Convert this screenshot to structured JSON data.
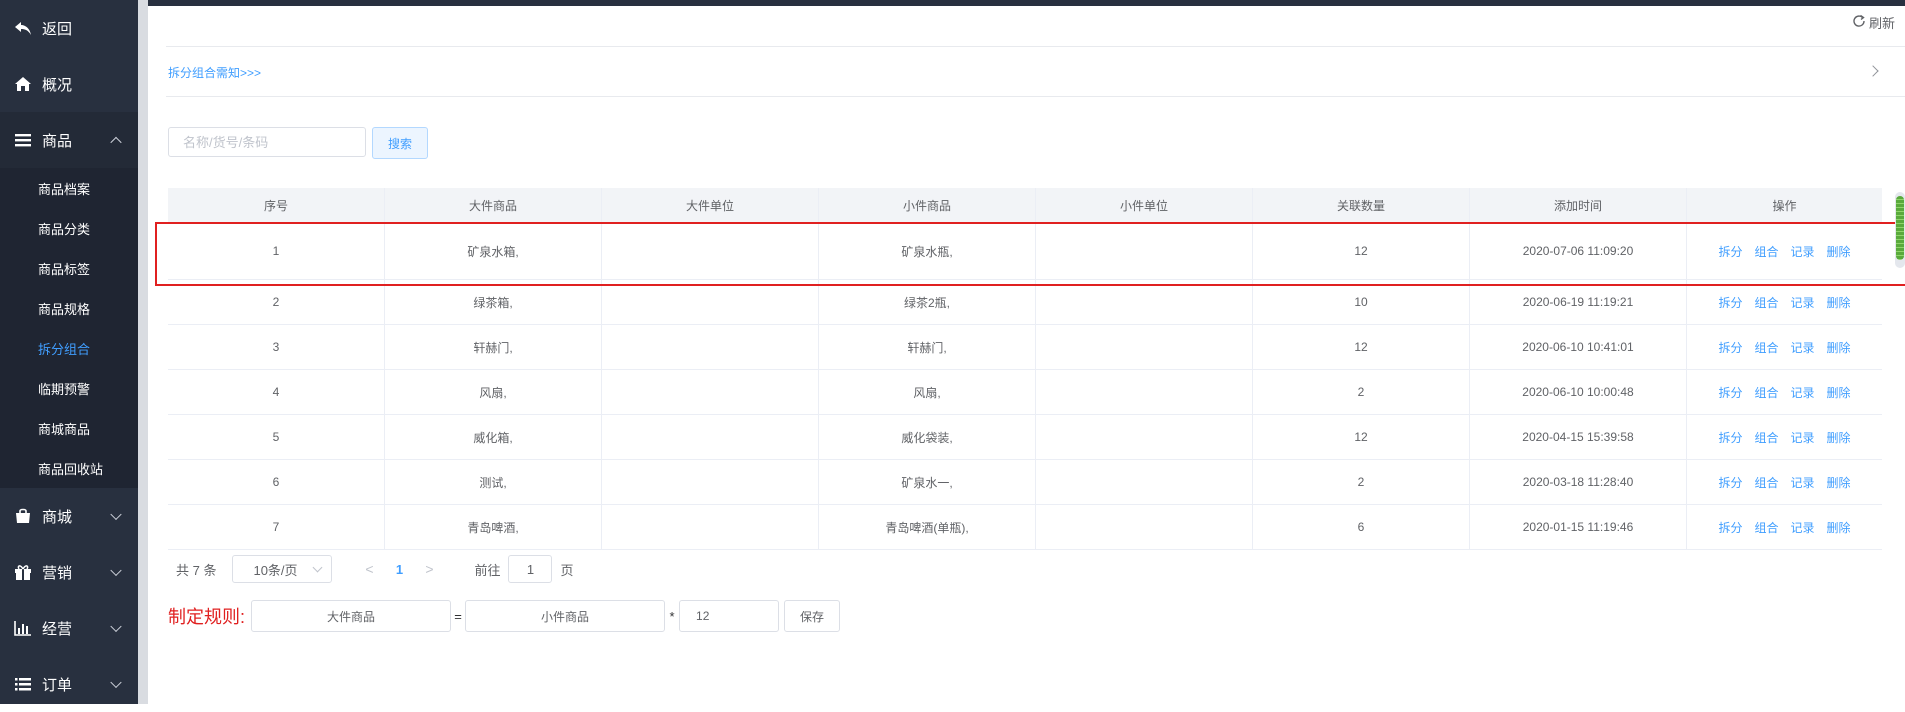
{
  "sidebar": {
    "back": {
      "label": "返回",
      "icon": "back-arrow-icon"
    },
    "overview": {
      "label": "概况",
      "icon": "home-icon"
    },
    "goods": {
      "label": "商品",
      "icon": "menu-icon"
    },
    "goods_sub": [
      "商品档案",
      "商品分类",
      "商品标签",
      "商品规格",
      "拆分组合",
      "临期预警",
      "商城商品",
      "商品回收站"
    ],
    "active_sub": "拆分组合",
    "mall": {
      "label": "商城",
      "icon": "shopping-bag-icon"
    },
    "marketing": {
      "label": "营销",
      "icon": "gift-icon"
    },
    "operation": {
      "label": "经营",
      "icon": "bar-chart-icon"
    },
    "orders": {
      "label": "订单",
      "icon": "list-icon"
    }
  },
  "header": {
    "refresh_label": "刷新",
    "refresh_icon": "refresh-icon"
  },
  "notice": {
    "label": "拆分组合需知>>>"
  },
  "search": {
    "placeholder": "名称/货号/条码",
    "button_label": "搜索"
  },
  "table": {
    "columns": [
      "序号",
      "大件商品",
      "大件单位",
      "小件商品",
      "小件单位",
      "关联数量",
      "添加时间",
      "操作"
    ],
    "actions": [
      "拆分",
      "组合",
      "记录",
      "删除"
    ],
    "rows": [
      {
        "index": "1",
        "big": "矿泉水箱,",
        "big_unit": "",
        "small": "矿泉水瓶,",
        "small_unit": "",
        "qty": "12",
        "time": "2020-07-06 11:09:20"
      },
      {
        "index": "2",
        "big": "绿茶箱,",
        "big_unit": "",
        "small": "绿茶2瓶,",
        "small_unit": "",
        "qty": "10",
        "time": "2020-06-19 11:19:21"
      },
      {
        "index": "3",
        "big": "轩赫门,",
        "big_unit": "",
        "small": "轩赫门,",
        "small_unit": "",
        "qty": "12",
        "time": "2020-06-10 10:41:01"
      },
      {
        "index": "4",
        "big": "风扇,",
        "big_unit": "",
        "small": "风扇,",
        "small_unit": "",
        "qty": "2",
        "time": "2020-06-10 10:00:48"
      },
      {
        "index": "5",
        "big": "威化箱,",
        "big_unit": "",
        "small": "威化袋装,",
        "small_unit": "",
        "qty": "12",
        "time": "2020-04-15 15:39:58"
      },
      {
        "index": "6",
        "big": "测试,",
        "big_unit": "",
        "small": "矿泉水一,",
        "small_unit": "",
        "qty": "2",
        "time": "2020-03-18 11:28:40"
      },
      {
        "index": "7",
        "big": "青岛啤酒,",
        "big_unit": "",
        "small": "青岛啤酒(单瓶),",
        "small_unit": "",
        "qty": "6",
        "time": "2020-01-15 11:19:46"
      }
    ]
  },
  "pagination": {
    "total": "共 7 条",
    "page_size": "10条/页",
    "prev": "<",
    "current": "1",
    "next": ">",
    "goto_label": "前往",
    "goto_value": "1",
    "goto_suffix": "页"
  },
  "rule": {
    "label": "制定规则:",
    "big_value": "大件商品",
    "equals": "=",
    "small_value": "小件商品",
    "times": "*",
    "qty_value": "12",
    "save_label": "保存"
  },
  "colors": {
    "sidebar_bg": "#28303f",
    "accent": "#409eff",
    "highlight": "#e02020"
  }
}
